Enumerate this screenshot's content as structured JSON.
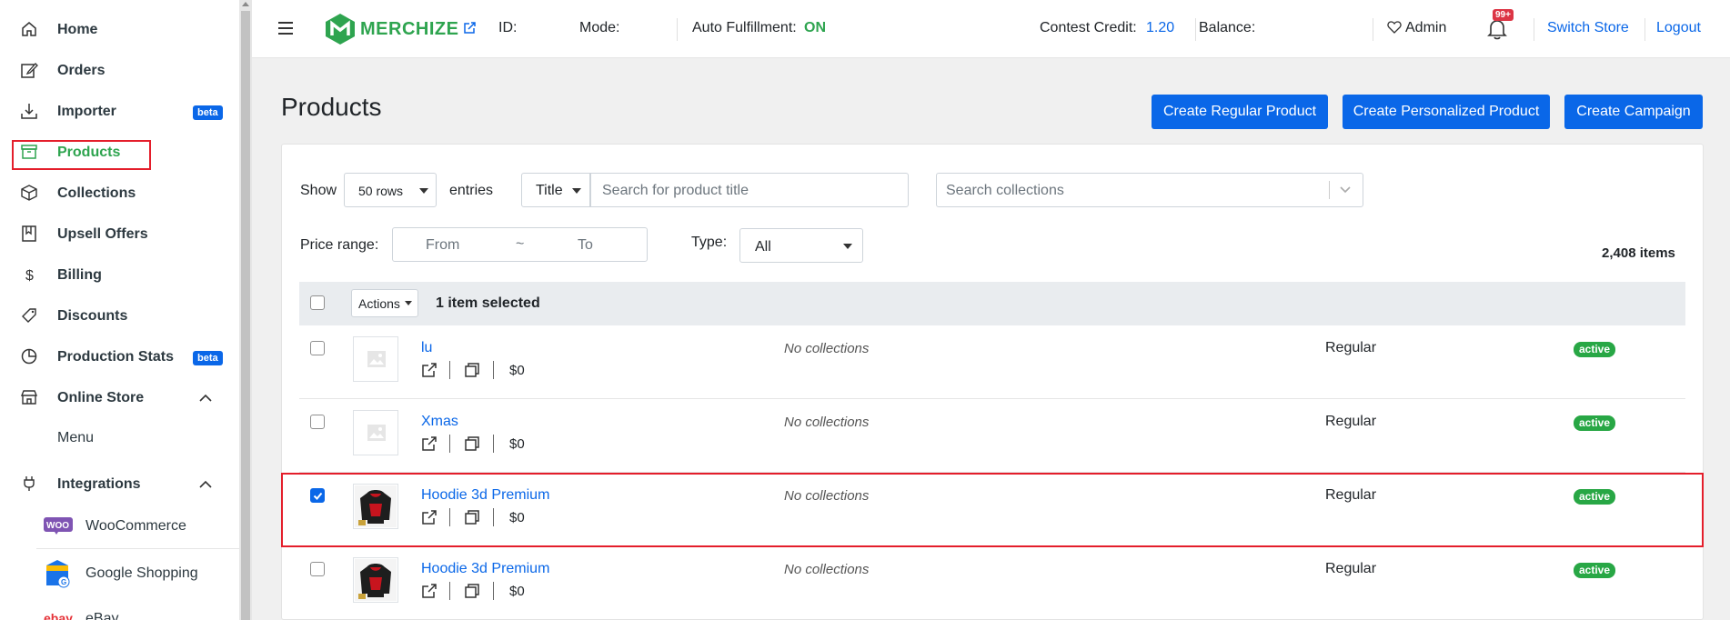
{
  "sidebar": {
    "items": [
      {
        "label": "Home",
        "icon": "home-icon"
      },
      {
        "label": "Orders",
        "icon": "edit-icon"
      },
      {
        "label": "Importer",
        "icon": "download-icon",
        "badge": "beta"
      },
      {
        "label": "Products",
        "icon": "archive-icon",
        "active": true
      },
      {
        "label": "Collections",
        "icon": "box-icon"
      },
      {
        "label": "Upsell Offers",
        "icon": "bookmark-icon"
      },
      {
        "label": "Billing",
        "icon": "dollar-icon"
      },
      {
        "label": "Discounts",
        "icon": "tag-icon"
      },
      {
        "label": "Production Stats",
        "icon": "pie-chart-icon",
        "badge": "beta"
      },
      {
        "label": "Online Store",
        "icon": "store-icon"
      },
      {
        "label": "Integrations",
        "icon": "plug-icon"
      }
    ],
    "online_store_sub": {
      "menu": "Menu"
    },
    "integrations_sub": [
      {
        "label": "WooCommerce",
        "icon": "woocommerce-icon",
        "logo_text": "WOO"
      },
      {
        "label": "Google Shopping",
        "icon": "google-shopping-icon"
      },
      {
        "label": "eBay",
        "icon": "ebay-icon",
        "logo_text": "ebay"
      }
    ]
  },
  "topbar": {
    "logo_text": "MERCHIZE",
    "id_label": "ID:",
    "mode_label": "Mode:",
    "auto_fulfillment_label": "Auto Fulfillment:",
    "auto_fulfillment_value": "ON",
    "contest_credit_label": "Contest Credit:",
    "contest_credit_value": "1.20",
    "balance_label": "Balance:",
    "admin_label": "Admin",
    "notification_badge": "99+",
    "switch_store": "Switch Store",
    "logout": "Logout"
  },
  "page": {
    "title": "Products",
    "buttons": {
      "create_regular": "Create Regular Product",
      "create_personalized": "Create Personalized Product",
      "create_campaign": "Create Campaign"
    }
  },
  "filters": {
    "show_label": "Show",
    "rows_value": "50 rows",
    "entries_label": "entries",
    "search_field_select": "Title",
    "search_placeholder": "Search for product title",
    "collections_placeholder": "Search collections",
    "price_range_label": "Price range:",
    "price_from_placeholder": "From",
    "price_sep": "~",
    "price_to_placeholder": "To",
    "type_label": "Type:",
    "type_value": "All",
    "total_items": "2,408 items"
  },
  "table": {
    "actions_label": "Actions",
    "selected_text": "1 item selected",
    "rows": [
      {
        "title": "lu",
        "price": "$0",
        "collections": "No collections",
        "type": "Regular",
        "status": "active",
        "checked": false,
        "image": "placeholder"
      },
      {
        "title": "Xmas",
        "price": "$0",
        "collections": "No collections",
        "type": "Regular",
        "status": "active",
        "checked": false,
        "image": "placeholder"
      },
      {
        "title": "Hoodie 3d Premium",
        "price": "$0",
        "collections": "No collections",
        "type": "Regular",
        "status": "active",
        "checked": true,
        "image": "hoodie"
      },
      {
        "title": "Hoodie 3d Premium",
        "price": "$0",
        "collections": "No collections",
        "type": "Regular",
        "status": "active",
        "checked": false,
        "image": "hoodie"
      }
    ]
  },
  "colors": {
    "accent": "#0a67e8",
    "active_green": "#2ea44f",
    "highlight_red": "#e41e2b"
  }
}
